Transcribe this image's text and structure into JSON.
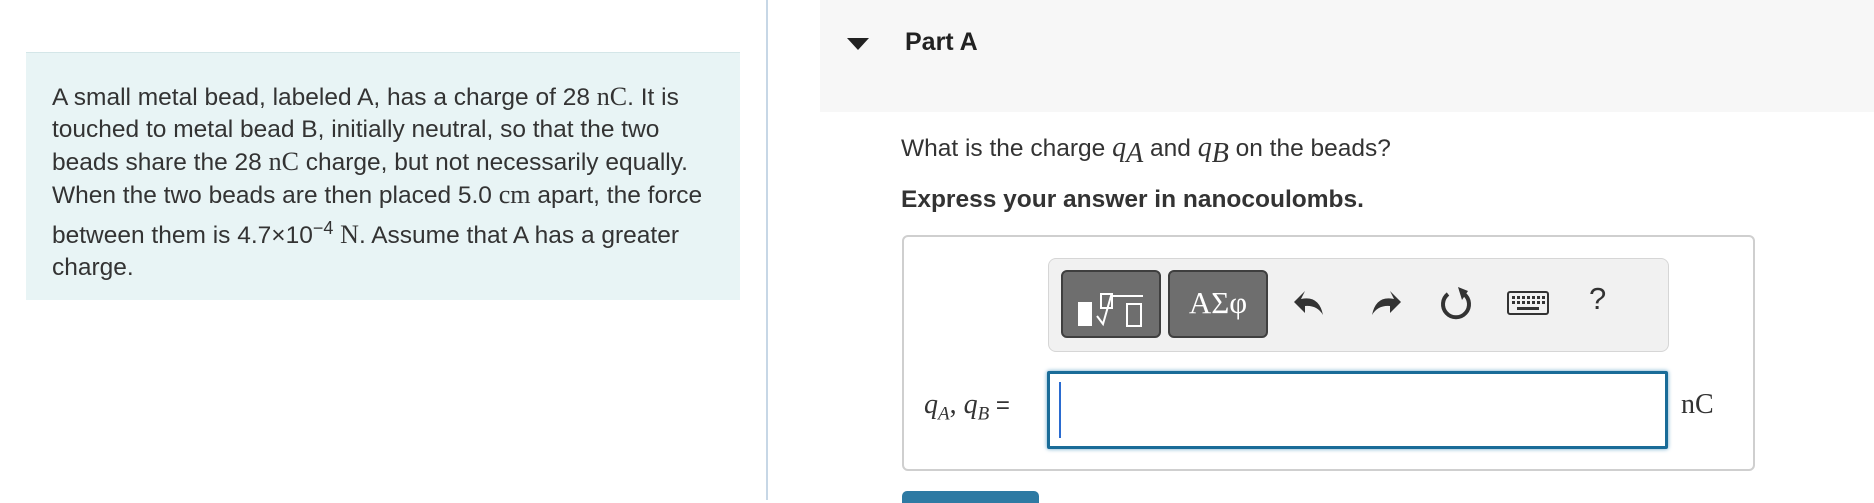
{
  "problem": {
    "t1": "A small metal bead, labeled A, has a charge of 28 ",
    "u1": "nC",
    "t2": ". It is touched to metal bead B, initially neutral, so that the two beads share the 28 ",
    "u2": "nC",
    "t3": " charge, but not necessarily equally. When the two beads are then placed 5.0 ",
    "u3": "cm",
    "t4": " apart, the force between them is 4.7×10",
    "exp": "−4",
    "u4": "N",
    "t5": ". Assume that A has a greater charge."
  },
  "part": {
    "title": "Part A"
  },
  "question": {
    "prefix": "What is the charge ",
    "q": "q",
    "subA": "A",
    "and": " and ",
    "subB": "B",
    "suffix": " on the beads?"
  },
  "instruction": "Express your answer in nanocoulombs.",
  "toolbar": {
    "symbols_label": "ΑΣφ",
    "help_label": "?",
    "icons": [
      "templates-icon",
      "undo-icon",
      "redo-icon",
      "reset-icon",
      "keyboard-icon"
    ]
  },
  "answer": {
    "q": "q",
    "subA": "A",
    "comma": ", ",
    "subB": "B",
    "equals": " =",
    "value": "",
    "unit": "nC"
  },
  "colors": {
    "problem_bg": "#e8f4f5",
    "button_gray": "#6e6e6e",
    "input_border": "#1a6c98",
    "submit_blue": "#2e7aa3"
  }
}
